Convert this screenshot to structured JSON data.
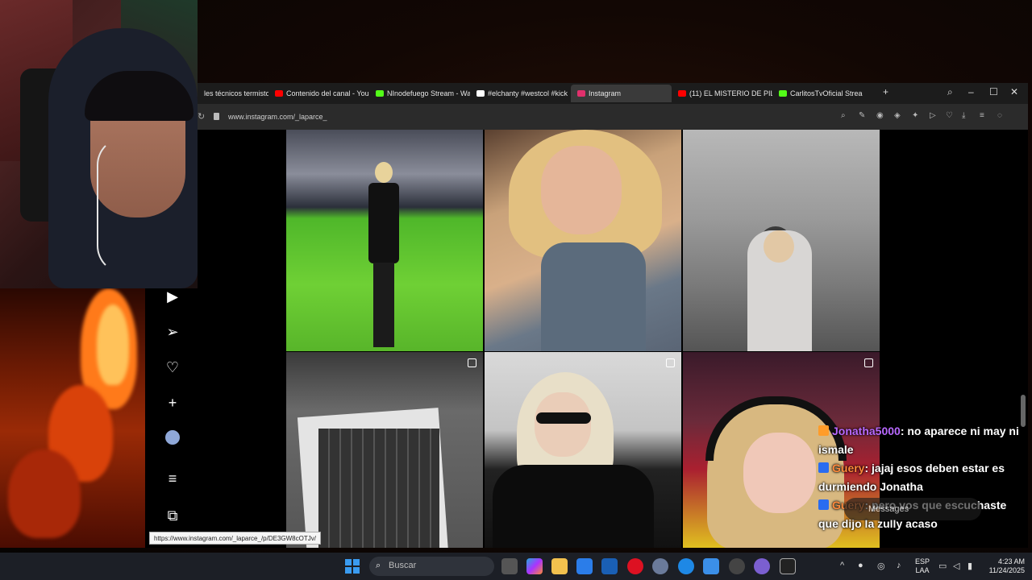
{
  "browser": {
    "tabs": [
      {
        "label": "les técnicos termistor",
        "color": "#e6e6e6"
      },
      {
        "label": "Contenido del canal - You",
        "color": "#ff0000"
      },
      {
        "label": "NInodefuego Stream - Wa",
        "color": "#53fc18"
      },
      {
        "label": "#elchanty #westcol #kick",
        "color": "#ffffff"
      },
      {
        "label": "Instagram",
        "color": "#e1306c"
      },
      {
        "label": "(11) EL MISTERIO DE PILL/",
        "color": "#ff0000"
      },
      {
        "label": "CarlitosTvOficial Strea",
        "color": "#53fc18"
      }
    ],
    "url": "www.instagram.com/_laparce_"
  },
  "status_link": "https://www.instagram.com/_laparce_/p/DE3GW8cOTJv/",
  "messages_label": "Messages",
  "chat": [
    {
      "user": "Jonatha5000",
      "text": ": no aparece ni may ni ismale"
    },
    {
      "user": "Guery",
      "text": ": jajaj esos deben estar es durmiendo Jonatha"
    },
    {
      "user": "Guery",
      "text": ": pero vos que escuchaste que dijo la zully acaso"
    }
  ],
  "taskbar": {
    "search_placeholder": "Buscar",
    "lang_top": "ESP",
    "lang_bottom": "LAA",
    "time": "4:23 AM",
    "date": "11/24/2025"
  }
}
